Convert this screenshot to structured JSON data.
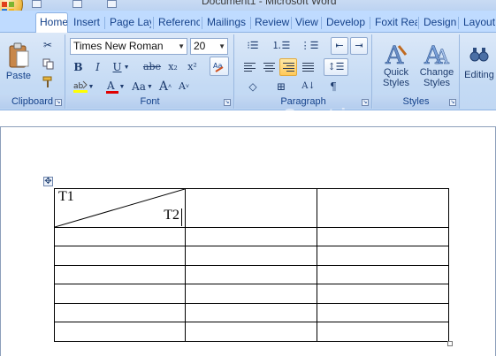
{
  "window": {
    "title": "Document1 - Microsoft Word"
  },
  "tabs": [
    {
      "label": "Home",
      "active": true
    },
    {
      "label": "Insert"
    },
    {
      "label": "Page Lay"
    },
    {
      "label": "Referenc"
    },
    {
      "label": "Mailings"
    },
    {
      "label": "Review"
    },
    {
      "label": "View"
    },
    {
      "label": "Develop"
    },
    {
      "label": "Foxit Rea"
    },
    {
      "label": "Design"
    },
    {
      "label": "Layout"
    }
  ],
  "clipboard": {
    "label": "Clipboard",
    "paste_label": "Paste",
    "cut_icon": "scissors-icon",
    "copy_icon": "copy-icon",
    "format_painter_icon": "paintbrush-icon"
  },
  "font": {
    "label": "Font",
    "family": "Times New Roman",
    "size": "20",
    "bold": "B",
    "italic": "I",
    "underline": "U",
    "strikethrough": "abe",
    "subscript": "x₂",
    "superscript": "x²",
    "change_case": "Aa",
    "grow": "A",
    "shrink": "A",
    "font_color_bar": "#e00000",
    "highlight_bar": "#ffff00"
  },
  "paragraph": {
    "label": "Paragraph",
    "align_right_active": true
  },
  "styles": {
    "label": "Styles",
    "quick_styles": "Quick Styles",
    "quick_line1": "Quick",
    "quick_line2": "Styles",
    "change_line1": "Change",
    "change_line2": "Styles"
  },
  "editing": {
    "label": "Editing"
  },
  "watermark": "Quantrimang",
  "table": {
    "cell_top_left": "T1",
    "cell_bottom_right": "T2",
    "rows": 7,
    "cols": 3
  }
}
